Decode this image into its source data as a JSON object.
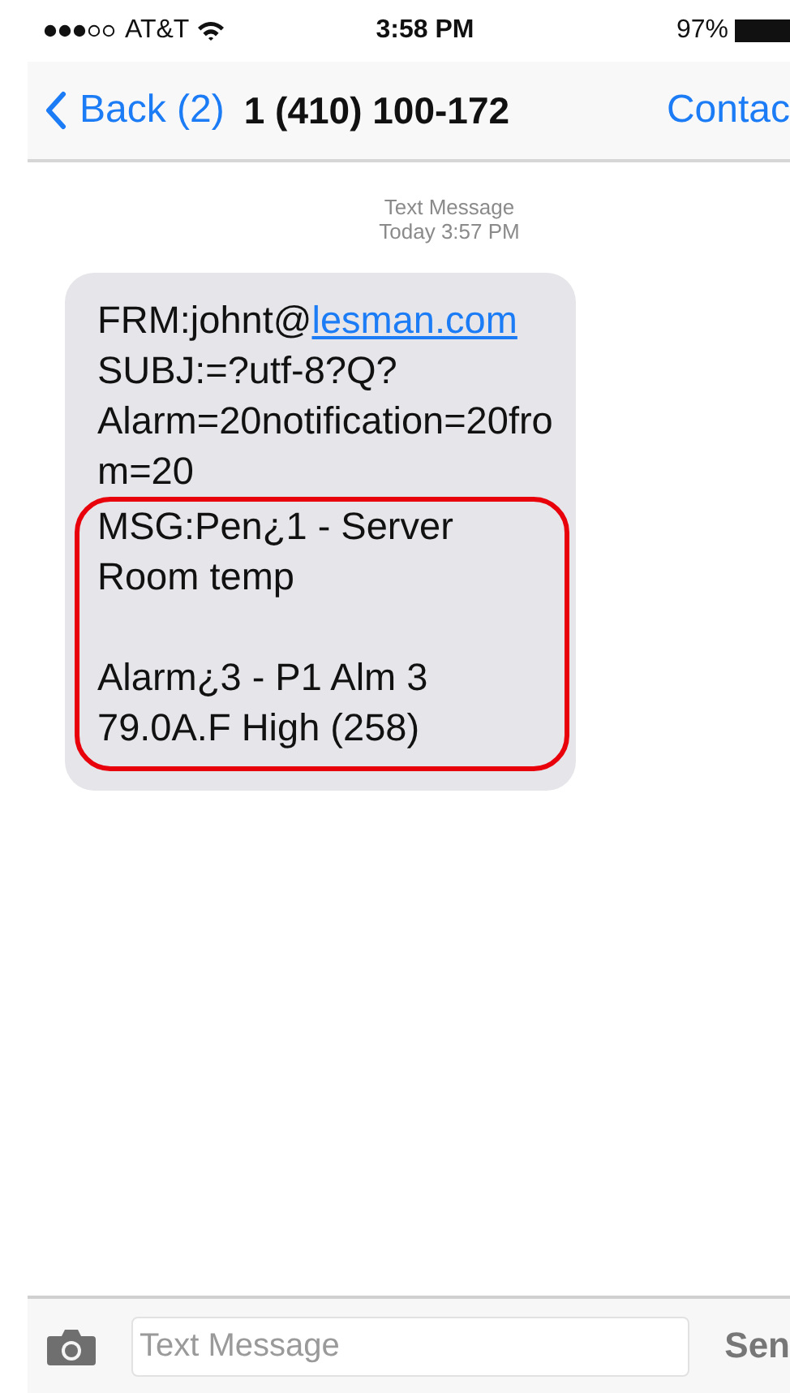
{
  "status_bar": {
    "carrier": "AT&T",
    "time": "3:58 PM",
    "battery": "97%"
  },
  "nav_bar": {
    "back": "Back (2)",
    "title": "1 (410) 100-172",
    "action": "Contac"
  },
  "thread_header": {
    "kind_label": "Text Message",
    "timestamp": "Today 3:57 PM"
  },
  "message": {
    "sections": [
      {
        "highlighted": false,
        "paragraphs": [
          {
            "lines": [
              {
                "text": "FRM:johnt@",
                "link": "lesman.com"
              },
              {
                "text": "SUBJ:=?utf-8?Q?"
              },
              {
                "text": "Alarm=20notification=20fro"
              },
              {
                "text": "m=20"
              }
            ]
          }
        ]
      },
      {
        "highlighted": true,
        "paragraphs": [
          {
            "lines": [
              {
                "text": "MSG:Pen¿1 - Server"
              },
              {
                "text": "Room temp"
              }
            ]
          },
          {
            "lines": [
              {
                "text": "Alarm¿3 - P1 Alm 3"
              },
              {
                "text": "79.0A.F High (258)"
              }
            ]
          }
        ]
      }
    ]
  },
  "input_bar": {
    "placeholder": "Text Message",
    "send": "Sen"
  }
}
